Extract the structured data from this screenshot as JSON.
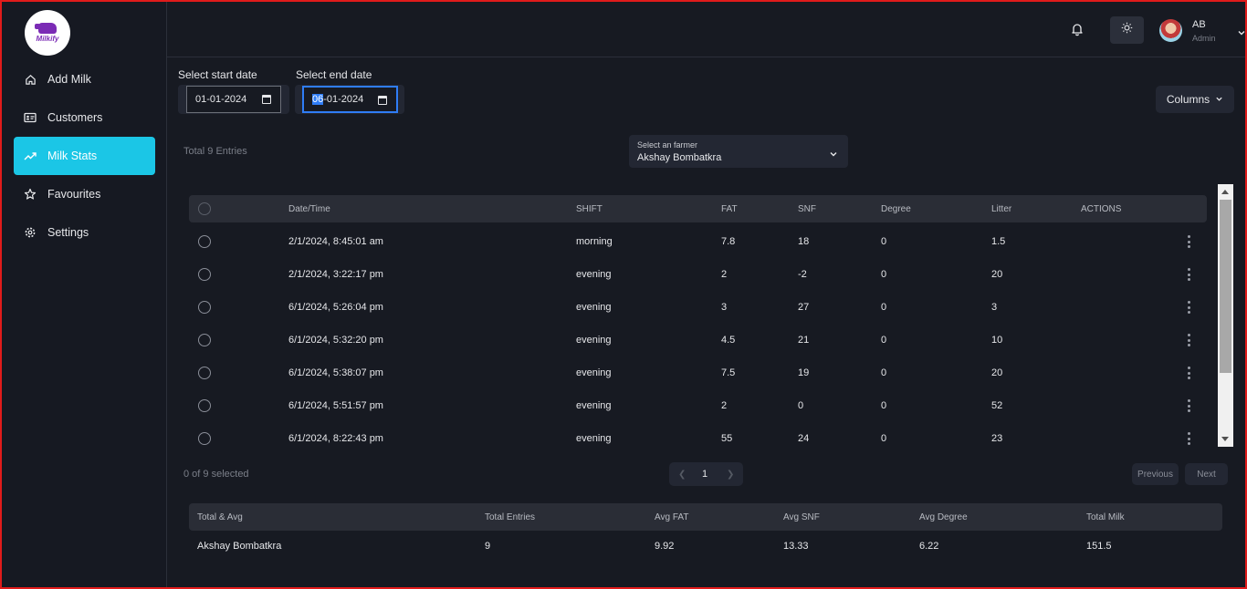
{
  "brand": {
    "name": "Milkify"
  },
  "nav": [
    {
      "label": "Add Milk",
      "icon": "home-icon"
    },
    {
      "label": "Customers",
      "icon": "id-card-icon"
    },
    {
      "label": "Milk Stats",
      "icon": "trending-up-icon",
      "active": true
    },
    {
      "label": "Favourites",
      "icon": "star-icon"
    },
    {
      "label": "Settings",
      "icon": "gear-icon"
    }
  ],
  "user": {
    "initials": "AB",
    "role": "Admin"
  },
  "filters": {
    "start_label": "Select start date",
    "start_value": "01-01-2024",
    "end_label": "Select end date",
    "end_value_selected": "06",
    "end_value_rest": "-01-2024",
    "columns_label": "Columns"
  },
  "summary_line": "Total 9 Entries",
  "farmer_select": {
    "caption": "Select an farmer",
    "value": "Akshay Bombatkra"
  },
  "table": {
    "headers": [
      "Date/Time",
      "SHIFT",
      "FAT",
      "SNF",
      "Degree",
      "Litter",
      "ACTIONS"
    ],
    "rows": [
      [
        "2/1/2024, 8:45:01 am",
        "morning",
        "7.8",
        "18",
        "0",
        "1.5"
      ],
      [
        "2/1/2024, 3:22:17 pm",
        "evening",
        "2",
        "-2",
        "0",
        "20"
      ],
      [
        "6/1/2024, 5:26:04 pm",
        "evening",
        "3",
        "27",
        "0",
        "3"
      ],
      [
        "6/1/2024, 5:32:20 pm",
        "evening",
        "4.5",
        "21",
        "0",
        "10"
      ],
      [
        "6/1/2024, 5:38:07 pm",
        "evening",
        "7.5",
        "19",
        "0",
        "20"
      ],
      [
        "6/1/2024, 5:51:57 pm",
        "evening",
        "2",
        "0",
        "0",
        "52"
      ],
      [
        "6/1/2024, 8:22:43 pm",
        "evening",
        "55",
        "24",
        "0",
        "23"
      ]
    ]
  },
  "pagination": {
    "selected_text": "0 of 9 selected",
    "page": "1",
    "prev_label": "Previous",
    "next_label": "Next"
  },
  "totals": {
    "headers": [
      "Total & Avg",
      "Total Entries",
      "Avg FAT",
      "Avg SNF",
      "Avg Degree",
      "Total Milk"
    ],
    "row": [
      "Akshay Bombatkra",
      "9",
      "9.92",
      "13.33",
      "6.22",
      "151.5"
    ]
  },
  "colors": {
    "accent": "#1bc6e6",
    "focus": "#2f7df6",
    "frame": "#e01b1b"
  }
}
